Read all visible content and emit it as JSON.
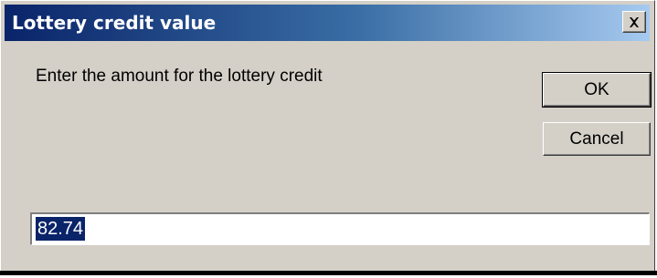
{
  "window": {
    "title": "Lottery credit value",
    "close_icon": "close-icon"
  },
  "prompt": {
    "text": "Enter the amount for the lottery credit"
  },
  "buttons": {
    "ok_label": "OK",
    "cancel_label": "Cancel"
  },
  "input": {
    "value": "82.74",
    "selected": true
  },
  "colors": {
    "title_bar_start": "#0a246a",
    "title_bar_end": "#a6caf0",
    "dialog_face": "#d4d0c8",
    "selection": "#0a246a"
  }
}
